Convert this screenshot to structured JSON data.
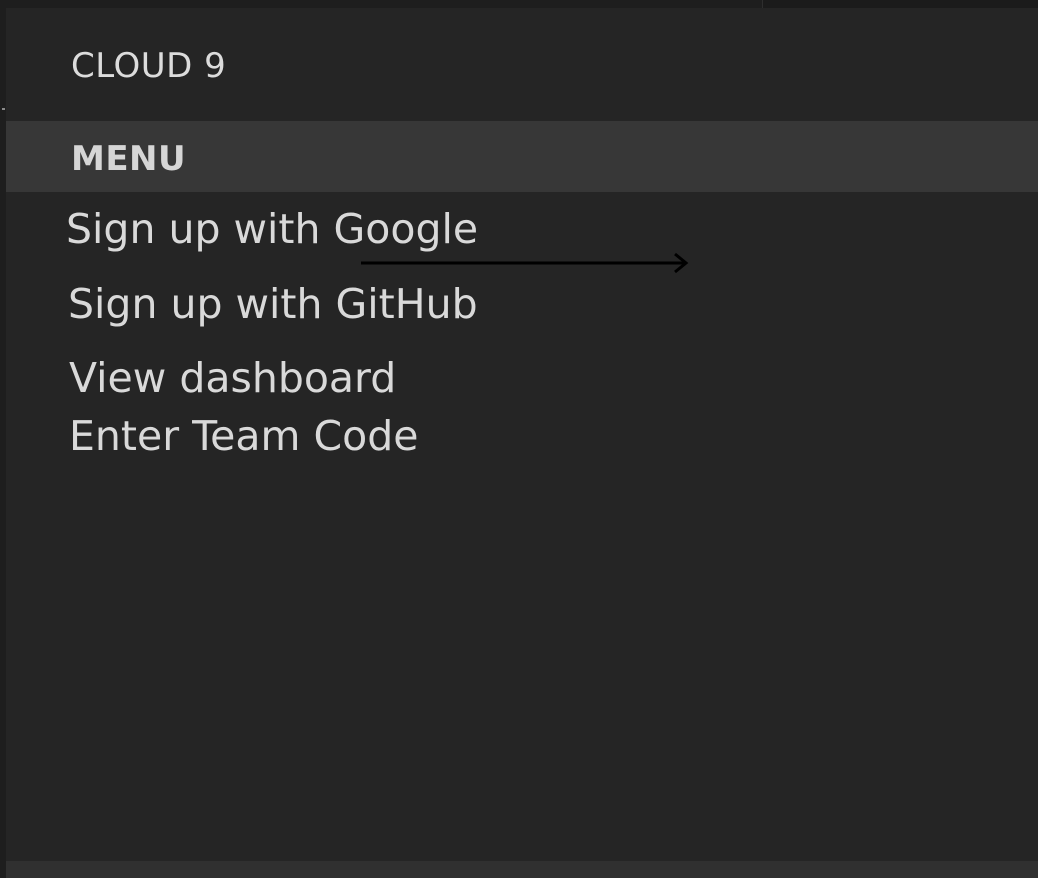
{
  "app": {
    "title": "CLOUD 9"
  },
  "menu": {
    "section_title": "MENU",
    "items": [
      {
        "label": "Sign up with Google"
      },
      {
        "label": "Sign up with GitHub"
      },
      {
        "label": "View dashboard"
      },
      {
        "label": "Enter Team Code"
      }
    ]
  },
  "colors": {
    "panel_background": "#252525",
    "section_bar": "#373737",
    "text": "#d9d9d9",
    "arrow": "#000000"
  },
  "icons": {
    "annotation": "arrow-right-icon"
  }
}
